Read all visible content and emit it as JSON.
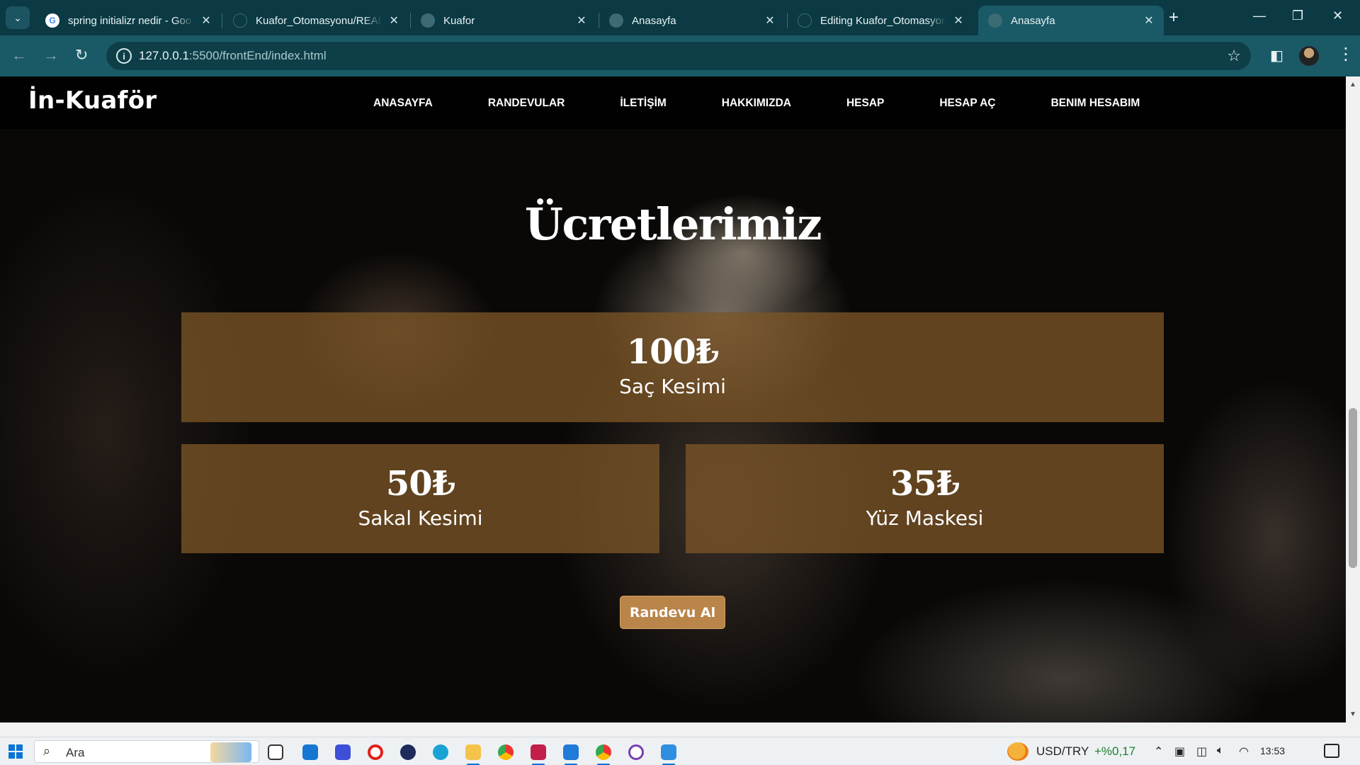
{
  "browser": {
    "tabs": [
      {
        "title": "spring initializr nedir - Goo",
        "favicon": "google-icon"
      },
      {
        "title": "Kuafor_Otomasyonu/READ",
        "favicon": "github-icon"
      },
      {
        "title": "Kuafor",
        "favicon": "globe-icon"
      },
      {
        "title": "Anasayfa",
        "favicon": "globe-icon"
      },
      {
        "title": "Editing Kuafor_Otomasyon",
        "favicon": "github-icon"
      },
      {
        "title": "Anasayfa",
        "favicon": "globe-icon",
        "active": true
      }
    ],
    "address": {
      "host": "127.0.0.1",
      "path": ":5500/frontEnd/index.html"
    }
  },
  "site": {
    "logo": "İn-Kuaför",
    "menu": [
      "ANASAYFA",
      "RANDEVULAR",
      "İLETİŞİM",
      "HAKKIMIZDA",
      "HESAP",
      "HESAP AÇ",
      "BENIM HESABIM"
    ],
    "heading": "Ücretlerimiz",
    "prices": [
      {
        "price": "100₺",
        "name": "Saç Kesimi"
      },
      {
        "price": "50₺",
        "name": "Sakal Kesimi"
      },
      {
        "price": "35₺",
        "name": "Yüz Maskesi"
      }
    ],
    "cta": "Randevu Al"
  },
  "taskbar": {
    "search_placeholder": "Ara",
    "ticker_symbol": "USD/TRY",
    "ticker_change": "+%0,17",
    "clock": "13:53"
  },
  "colors": {
    "chrome_dark": "#0b3a44",
    "chrome": "#1a5a66",
    "card": "#7a5426",
    "cta": "#b98549"
  }
}
